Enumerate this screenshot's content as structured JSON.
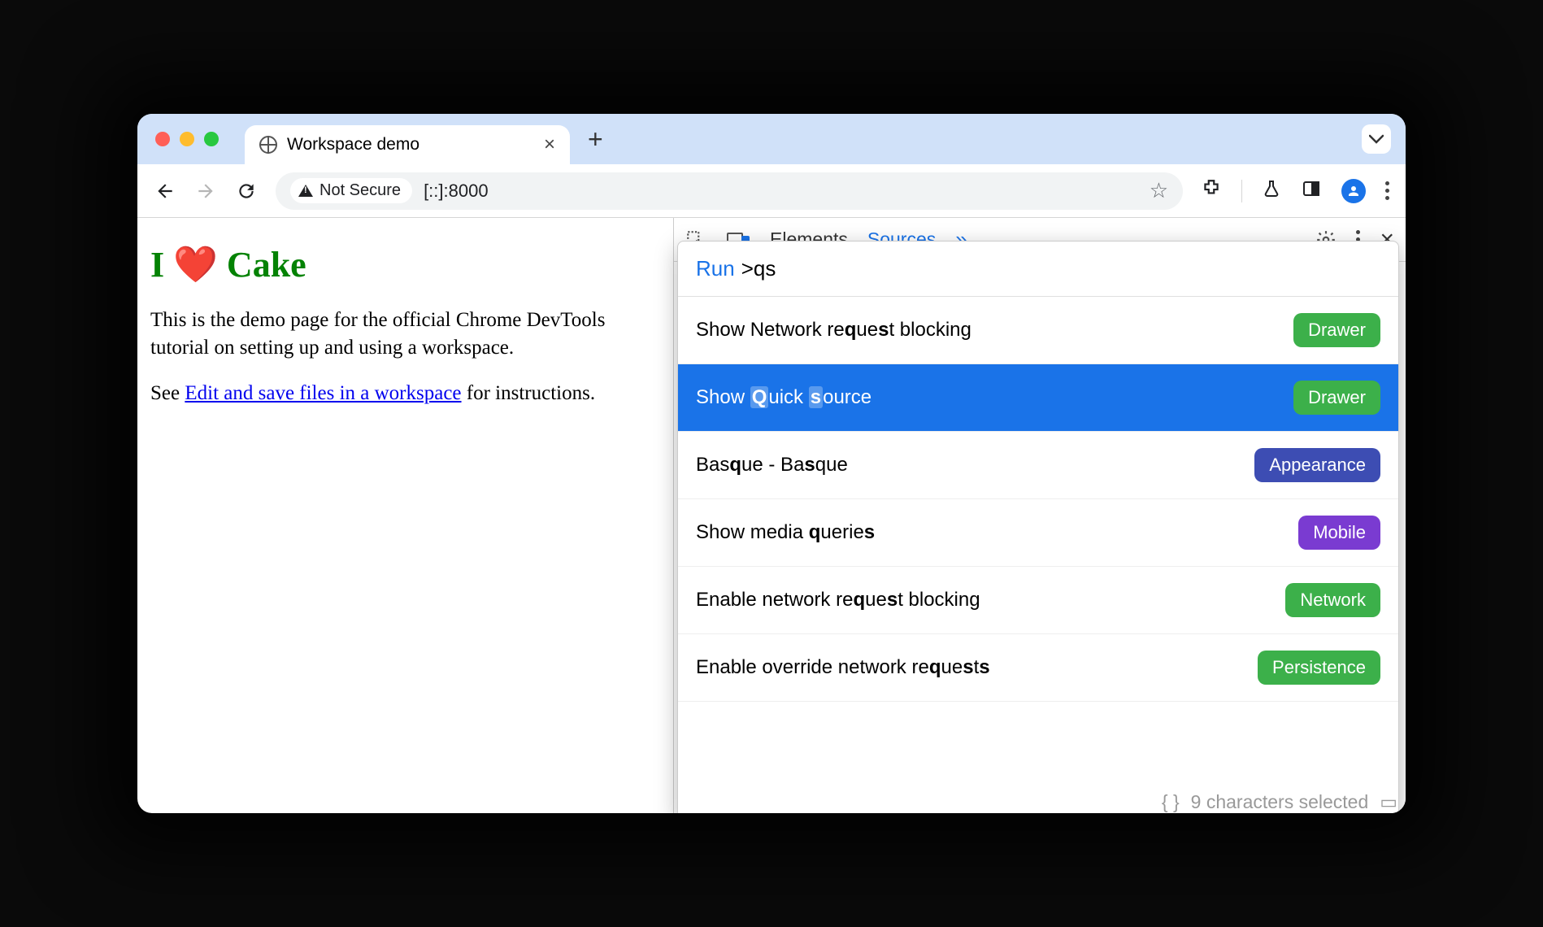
{
  "browser": {
    "tab_title": "Workspace demo",
    "not_secure_label": "Not Secure",
    "url": "[::]:8000"
  },
  "page": {
    "heading_prefix": "I ",
    "heading_suffix": " Cake",
    "p1": "This is the demo page for the official Chrome DevTools tutorial on setting up and using a workspace.",
    "p2_prefix": "See ",
    "p2_link": "Edit and save files in a workspace",
    "p2_suffix": " for instructions."
  },
  "devtools": {
    "tabs": {
      "elements": "Elements",
      "sources": "Sources"
    },
    "cmd": {
      "run_label": "Run",
      "query": ">qs",
      "items": [
        {
          "pre": "Show Network re",
          "b1": "q",
          "mid1": "ue",
          "b2": "s",
          "mid2": "t blocking",
          "badge": "Drawer",
          "badge_class": "b-drawer"
        },
        {
          "pre": "Show ",
          "b1": "Q",
          "mid1": "uick ",
          "b2": "s",
          "mid2": "ource",
          "badge": "Drawer",
          "badge_class": "b-drawer",
          "selected": true
        },
        {
          "pre": "Bas",
          "b1": "q",
          "mid1": "ue - Ba",
          "b2": "s",
          "mid2": "que",
          "badge": "Appearance",
          "badge_class": "b-appearance"
        },
        {
          "pre": "Show media ",
          "b1": "q",
          "mid1": "uerie",
          "b2": "s",
          "mid2": "",
          "badge": "Mobile",
          "badge_class": "b-mobile"
        },
        {
          "pre": "Enable network re",
          "b1": "q",
          "mid1": "ue",
          "b2": "s",
          "mid2": "t blocking",
          "badge": "Network",
          "badge_class": "b-network"
        },
        {
          "pre": "Enable override network re",
          "b1": "q",
          "mid1": "ue",
          "b2": "s",
          "mid2": "t",
          "b3": "s",
          "badge": "Persistence",
          "badge_class": "b-persistence"
        }
      ]
    },
    "status": "9 characters selected"
  }
}
